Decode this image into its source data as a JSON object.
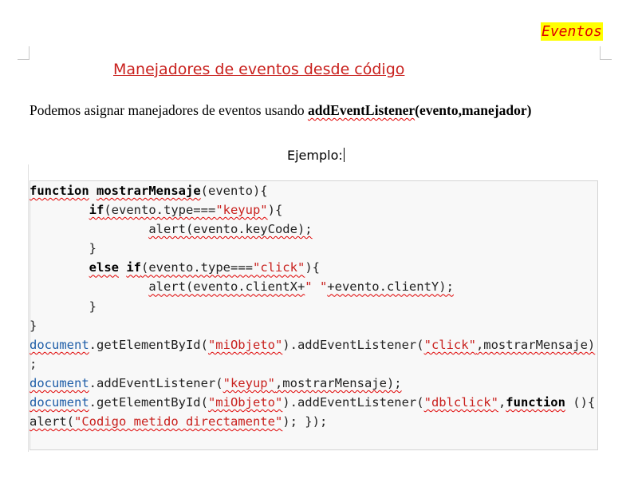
{
  "header_tag": "Eventos",
  "title": "Manejadores de eventos desde código",
  "intro": {
    "text": "Podemos asignar manejadores de eventos usando ",
    "method": "addEventListener",
    "args": "(evento,manejador)"
  },
  "example_label": "Ejemplo:",
  "code": {
    "l1": {
      "kw": "function",
      "fn": "mostrarMensaje",
      "rest": "(evento){"
    },
    "l2": {
      "indent": "        ",
      "kw": "if",
      "a": "(evento.type===",
      "s": "\"keyup\"",
      "b": "){"
    },
    "l3": {
      "indent": "                ",
      "text": "alert(evento.keyCode);"
    },
    "l4": {
      "indent": "        ",
      "text": "}"
    },
    "l5": {
      "indent": "        ",
      "kw1": "else",
      "kw2": "if",
      "a": "(evento.type===",
      "s": "\"click\"",
      "b": "){"
    },
    "l6": {
      "indent": "                ",
      "a": "alert(evento.clientX+",
      "s": "\" \"",
      "b": "+evento.clientY);"
    },
    "l7": {
      "indent": "        ",
      "text": "}"
    },
    "l8": {
      "text": "}"
    },
    "l9": {
      "obj": "document",
      "a": ".getElementById(",
      "s1": "\"miObjeto\"",
      "b": ").addEventListener(",
      "s2": "\"click\"",
      "c": ",mostrarMensaje)"
    },
    "l10": {
      "text": ";"
    },
    "l11": {
      "obj": "document",
      "a": ".addEventListener(",
      "s": "\"keyup\"",
      "b": ",mostrarMensaje);"
    },
    "l12": {
      "obj": "document",
      "a": ".getElementById(",
      "s1": "\"miObjeto\"",
      "b": ").addEventListener(",
      "s2": "\"dblclick\"",
      "c": ",",
      "kw": "function",
      "d": " (){"
    },
    "l13": {
      "a": "alert(",
      "s": "\"Codigo metido directamente\"",
      "b": "); });"
    }
  }
}
